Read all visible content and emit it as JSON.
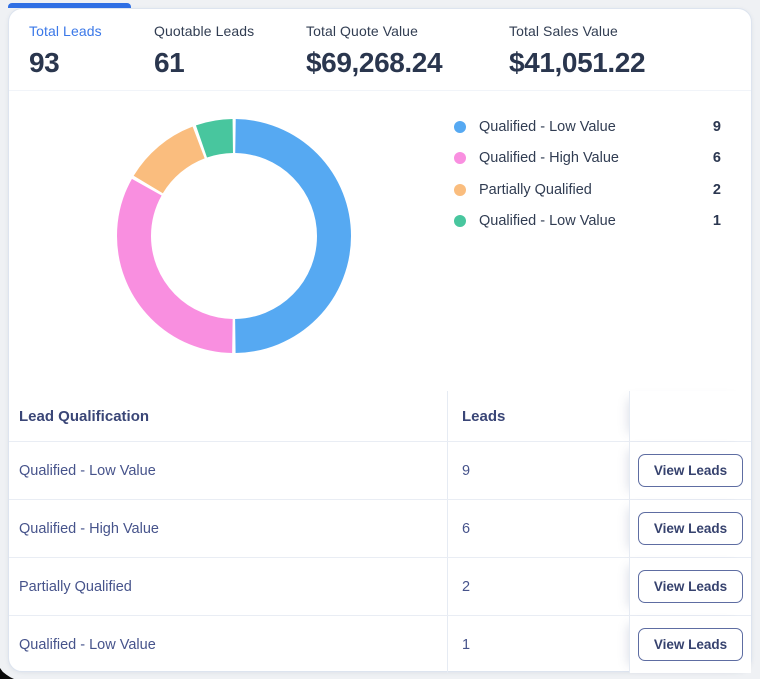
{
  "page": {
    "background": "#EFF1F4",
    "card_background": "#FFFFFF"
  },
  "stats": {
    "indicator_color": "#2F6FE4",
    "active_label_color": "#3B78E8",
    "tabs": [
      {
        "label": "Total Leads",
        "value": "93",
        "active": true
      },
      {
        "label": "Quotable Leads",
        "value": "61",
        "active": false
      },
      {
        "label": "Total Quote Value",
        "value": "$69,268.24",
        "active": false
      },
      {
        "label": "Total Sales Value",
        "value": "$41,051.22",
        "active": false
      }
    ]
  },
  "chart_data": {
    "type": "pie",
    "subtype": "donut",
    "categories": [
      "Qualified - Low Value",
      "Qualified - High Value",
      "Partially Qualified",
      "Qualified - Low Value"
    ],
    "values": [
      9,
      6,
      2,
      1
    ],
    "colors": [
      "#56A9F2",
      "#F98FE0",
      "#FABD7E",
      "#48C69E"
    ],
    "start_angle_deg": 0,
    "direction": "clockwise",
    "legend_position": "right",
    "title": ""
  },
  "legend": {
    "items": [
      {
        "label": "Qualified - Low Value",
        "value": "9",
        "color": "#56A9F2"
      },
      {
        "label": "Qualified - High Value",
        "value": "6",
        "color": "#F98FE0"
      },
      {
        "label": "Partially Qualified",
        "value": "2",
        "color": "#FABD7E"
      },
      {
        "label": "Qualified - Low Value",
        "value": "1",
        "color": "#48C69E"
      }
    ]
  },
  "table": {
    "headers": {
      "qualification": "Lead Qualification",
      "leads": "Leads",
      "actions": ""
    },
    "rows": [
      {
        "qualification": "Qualified - Low Value",
        "leads": "9",
        "action": "View Leads"
      },
      {
        "qualification": "Qualified - High Value",
        "leads": "6",
        "action": "View Leads"
      },
      {
        "qualification": "Partially Qualified",
        "leads": "2",
        "action": "View Leads"
      },
      {
        "qualification": "Qualified - Low Value",
        "leads": "1",
        "action": "View Leads"
      }
    ]
  }
}
